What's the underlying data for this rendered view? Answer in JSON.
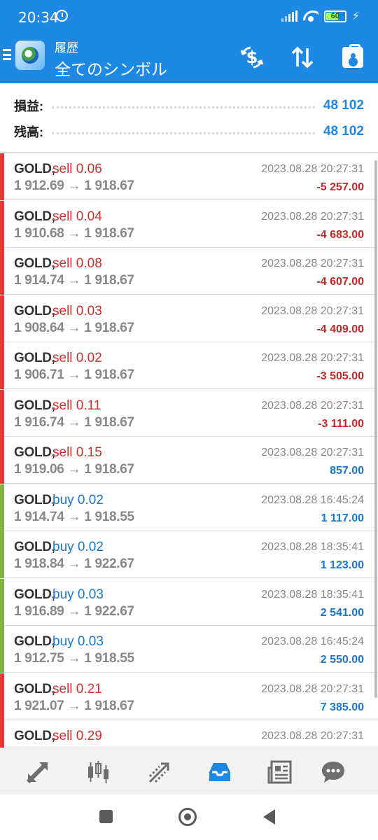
{
  "status_bar": {
    "time": "20:34",
    "battery": "60"
  },
  "app_bar": {
    "subtitle": "履歴",
    "title": "全てのシンボル",
    "icons": [
      "hamburger-menu-icon",
      "app-logo",
      "dollar-exchange-icon",
      "sort-icon",
      "report-icon"
    ]
  },
  "summary": {
    "profit_label": "損益:",
    "profit_value": "48 102",
    "balance_label": "残高:",
    "balance_value": "48 102"
  },
  "colors": {
    "accent": "#1e88e5",
    "sell": "#d32f2f",
    "buy": "#1976d2",
    "loss": "#c62828",
    "gain": "#1976d2",
    "sell_bar": "#e53935",
    "buy_bar": "#7cb342"
  },
  "trades": [
    {
      "symbol": "GOLD,",
      "side": "sell",
      "volume": "sell 0.06",
      "prices": "1 912.69 → 1 918.67",
      "time": "2023.08.28 20:27:31",
      "profit": "-5 257.00"
    },
    {
      "symbol": "GOLD,",
      "side": "sell",
      "volume": "sell 0.04",
      "prices": "1 910.68 → 1 918.67",
      "time": "2023.08.28 20:27:31",
      "profit": "-4 683.00"
    },
    {
      "symbol": "GOLD,",
      "side": "sell",
      "volume": "sell 0.08",
      "prices": "1 914.74 → 1 918.67",
      "time": "2023.08.28 20:27:31",
      "profit": "-4 607.00"
    },
    {
      "symbol": "GOLD,",
      "side": "sell",
      "volume": "sell 0.03",
      "prices": "1 908.64 → 1 918.67",
      "time": "2023.08.28 20:27:31",
      "profit": "-4 409.00"
    },
    {
      "symbol": "GOLD,",
      "side": "sell",
      "volume": "sell 0.02",
      "prices": "1 906.71 → 1 918.67",
      "time": "2023.08.28 20:27:31",
      "profit": "-3 505.00"
    },
    {
      "symbol": "GOLD,",
      "side": "sell",
      "volume": "sell 0.11",
      "prices": "1 916.74 → 1 918.67",
      "time": "2023.08.28 20:27:31",
      "profit": "-3 111.00"
    },
    {
      "symbol": "GOLD,",
      "side": "sell",
      "volume": "sell 0.15",
      "prices": "1 919.06 → 1 918.67",
      "time": "2023.08.28 20:27:31",
      "profit": "857.00"
    },
    {
      "symbol": "GOLD,",
      "side": "buy",
      "volume": "buy 0.02",
      "prices": "1 914.74 → 1 918.55",
      "time": "2023.08.28 16:45:24",
      "profit": "1 117.00"
    },
    {
      "symbol": "GOLD,",
      "side": "buy",
      "volume": "buy 0.02",
      "prices": "1 918.84 → 1 922.67",
      "time": "2023.08.28 18:35:41",
      "profit": "1 123.00"
    },
    {
      "symbol": "GOLD,",
      "side": "buy",
      "volume": "buy 0.03",
      "prices": "1 916.89 → 1 922.67",
      "time": "2023.08.28 18:35:41",
      "profit": "2 541.00"
    },
    {
      "symbol": "GOLD,",
      "side": "buy",
      "volume": "buy 0.03",
      "prices": "1 912.75 → 1 918.55",
      "time": "2023.08.28 16:45:24",
      "profit": "2 550.00"
    },
    {
      "symbol": "GOLD,",
      "side": "sell",
      "volume": "sell 0.21",
      "prices": "1 921.07 → 1 918.67",
      "time": "2023.08.28 20:27:31",
      "profit": "7 385.00"
    },
    {
      "symbol": "GOLD,",
      "side": "sell",
      "volume": "sell 0.29",
      "prices": "",
      "time": "2023.08.28 20:27:31",
      "profit": ""
    }
  ],
  "bottom_nav": {
    "items": [
      "quotes-arrows-icon",
      "chart-candles-icon",
      "trade-icon",
      "history-inbox-icon",
      "news-icon",
      "chat-icon"
    ],
    "active": 3
  },
  "system_nav": [
    "recents-square-icon",
    "home-circle-icon",
    "back-triangle-icon"
  ]
}
